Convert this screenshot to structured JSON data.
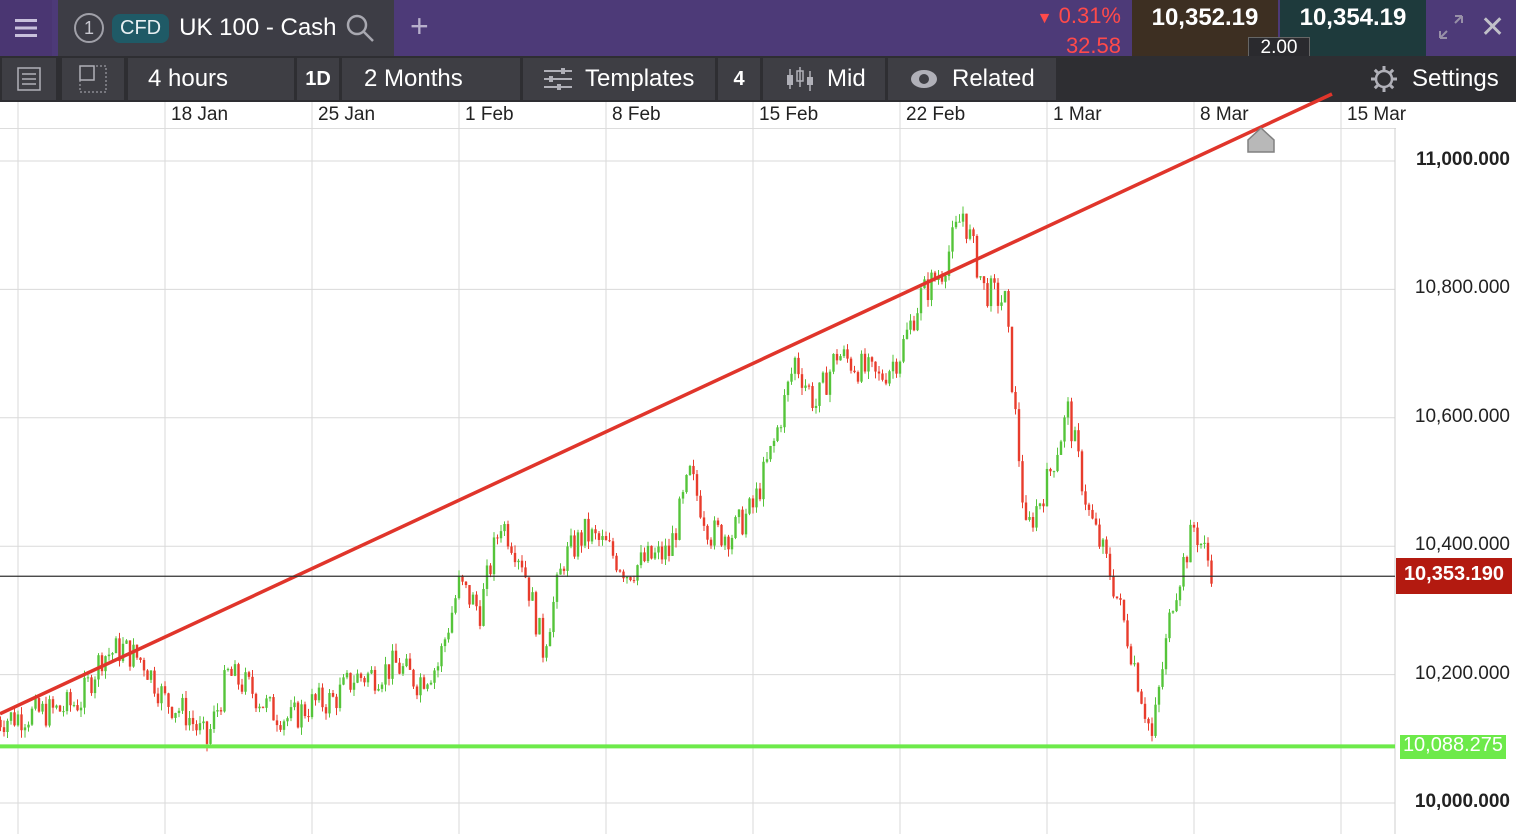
{
  "header": {
    "tab_number": "1",
    "instrument_type": "CFD",
    "instrument_name": "UK 100 - Cash",
    "change_percent": "0.31%",
    "change_points": "32.58",
    "bid": "10,352.19",
    "ask": "10,354.19",
    "spread": "2.00"
  },
  "toolbar": {
    "interval": "4 hours",
    "period_badge": "1D",
    "range": "2 Months",
    "templates": "Templates",
    "templates_count": "4",
    "price_type": "Mid",
    "related": "Related",
    "settings": "Settings"
  },
  "chart_data": {
    "type": "candlestick",
    "instrument": "UK 100 - Cash",
    "x_tick_labels": [
      "18 Jan",
      "25 Jan",
      "1 Feb",
      "8 Feb",
      "15 Feb",
      "22 Feb",
      "1 Mar",
      "8 Mar",
      "15 Mar"
    ],
    "y_tick_labels": [
      "11,000.000",
      "10,800.000",
      "10,600.000",
      "10,400.000",
      "10,200.000",
      "10,000.000"
    ],
    "ylim": [
      9990,
      11050
    ],
    "grid": true,
    "current_price_label": "10,353.190",
    "current_price": 10353.19,
    "support_label": "10,088.275",
    "support_level": 10088.275,
    "trendline": {
      "from": {
        "date": "2025-01-11",
        "price": 10152
      },
      "to": {
        "date": "2025-03-11",
        "price": 11050
      }
    },
    "colors": {
      "up": "#55c43a",
      "down": "#e83c2c",
      "trendline": "#e0352b",
      "support": "#6dea4a",
      "price_tag": "#b31a10"
    },
    "closes": [
      {
        "d": "10 Jan",
        "p": 10130
      },
      {
        "d": "11 Jan",
        "p": 10135
      },
      {
        "d": "12 Jan",
        "p": 10140
      },
      {
        "d": "13 Jan",
        "p": 10145
      },
      {
        "d": "14 Jan",
        "p": 10160
      },
      {
        "d": "15 Jan",
        "p": 10230
      },
      {
        "d": "16 Jan",
        "p": 10240
      },
      {
        "d": "17 Jan",
        "p": 10220
      },
      {
        "d": "18 Jan",
        "p": 10160
      },
      {
        "d": "19 Jan",
        "p": 10140
      },
      {
        "d": "20 Jan",
        "p": 10095
      },
      {
        "d": "21 Jan",
        "p": 10200
      },
      {
        "d": "22 Jan",
        "p": 10180
      },
      {
        "d": "23 Jan",
        "p": 10145
      },
      {
        "d": "24 Jan",
        "p": 10130
      },
      {
        "d": "25 Jan",
        "p": 10155
      },
      {
        "d": "26 Jan",
        "p": 10160
      },
      {
        "d": "27 Jan",
        "p": 10195
      },
      {
        "d": "28 Jan",
        "p": 10200
      },
      {
        "d": "29 Jan",
        "p": 10215
      },
      {
        "d": "30 Jan",
        "p": 10190
      },
      {
        "d": "31 Jan",
        "p": 10215
      },
      {
        "d": "1 Feb",
        "p": 10340
      },
      {
        "d": "2 Feb",
        "p": 10300
      },
      {
        "d": "3 Feb",
        "p": 10440
      },
      {
        "d": "4 Feb",
        "p": 10380
      },
      {
        "d": "5 Feb",
        "p": 10240
      },
      {
        "d": "6 Feb",
        "p": 10380
      },
      {
        "d": "7 Feb",
        "p": 10420
      },
      {
        "d": "8 Feb",
        "p": 10400
      },
      {
        "d": "9 Feb",
        "p": 10360
      },
      {
        "d": "10 Feb",
        "p": 10380
      },
      {
        "d": "11 Feb",
        "p": 10390
      },
      {
        "d": "12 Feb",
        "p": 10510
      },
      {
        "d": "13 Feb",
        "p": 10420
      },
      {
        "d": "14 Feb",
        "p": 10420
      },
      {
        "d": "15 Feb",
        "p": 10460
      },
      {
        "d": "16 Feb",
        "p": 10560
      },
      {
        "d": "17 Feb",
        "p": 10690
      },
      {
        "d": "18 Feb",
        "p": 10620
      },
      {
        "d": "19 Feb",
        "p": 10700
      },
      {
        "d": "20 Feb",
        "p": 10680
      },
      {
        "d": "21 Feb",
        "p": 10660
      },
      {
        "d": "22 Feb",
        "p": 10700
      },
      {
        "d": "23 Feb",
        "p": 10790
      },
      {
        "d": "24 Feb",
        "p": 10830
      },
      {
        "d": "25 Feb",
        "p": 10920
      },
      {
        "d": "26 Feb",
        "p": 10800
      },
      {
        "d": "27 Feb",
        "p": 10780
      },
      {
        "d": "28 Feb",
        "p": 10420
      },
      {
        "d": "1 Mar",
        "p": 10500
      },
      {
        "d": "2 Mar",
        "p": 10610
      },
      {
        "d": "3 Mar",
        "p": 10450
      },
      {
        "d": "4 Mar",
        "p": 10360
      },
      {
        "d": "5 Mar",
        "p": 10240
      },
      {
        "d": "6 Mar",
        "p": 10100
      },
      {
        "d": "7 Mar",
        "p": 10320
      },
      {
        "d": "8 Mar",
        "p": 10430
      },
      {
        "d": "9 Mar",
        "p": 10353
      }
    ]
  }
}
